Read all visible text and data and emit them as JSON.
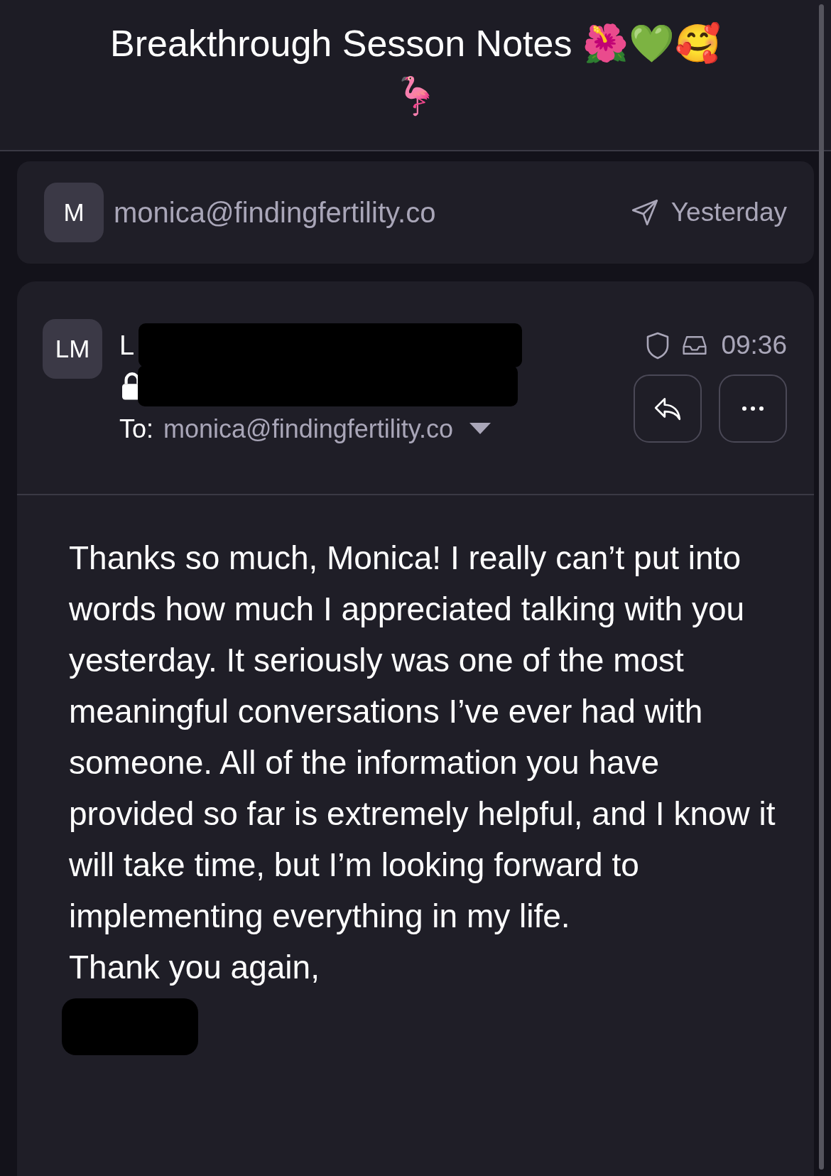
{
  "title": "Breakthrough Sesson Notes 🌺💚🥰 🦩",
  "thread_item": {
    "avatar": "M",
    "sender": "monica@findingfertility.co",
    "date": "Yesterday"
  },
  "message": {
    "avatar": "LM",
    "sender": "L",
    "redacted": true,
    "to_label": "To:",
    "to": "monica@findingfertility.co",
    "time": "09:36",
    "paragraphs": [
      "Thanks so much, Monica! I really can’t put into words how much I appreciated talking with you yesterday. It seriously was one of the most meaningful conversations I’ve ever had with someone. All of the information you have provided so far is extremely helpful, and I know it will take time, but I’m looking forward to implementing everything in my life.",
      "Thank you again,"
    ],
    "signature_redacted": true
  }
}
